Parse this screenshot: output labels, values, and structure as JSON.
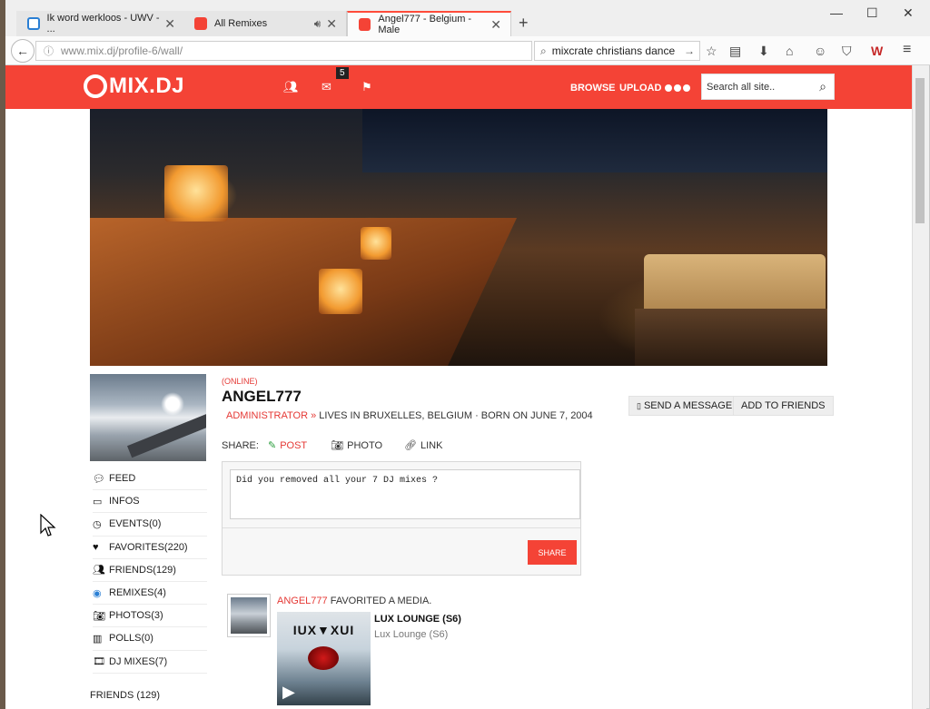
{
  "browser": {
    "tabs": [
      {
        "label": "Ik word werkloos - UWV - ...",
        "fav_color": "#2a7fd4"
      },
      {
        "label": "All Remixes",
        "fav_color": "#f44336"
      },
      {
        "label": "Angel777 - Belgium - Male",
        "fav_color": "#f44336"
      }
    ],
    "url_prefix": "www.mix.dj",
    "url_path": "/profile-6/wall/",
    "search_query": "mixcrate christians dance",
    "accent": "#ff4b3a"
  },
  "site": {
    "logo": "MIX.DJ",
    "message_count": "5",
    "nav_browse": "BROWSE",
    "nav_upload": "UPLOAD",
    "search_placeholder": "Search all site..",
    "brand_color": "#f44336"
  },
  "profile": {
    "status": "(ONLINE)",
    "username": "ANGEL777",
    "role": "ADMINISTRATOR »",
    "details": "LIVES IN BRUXELLES, BELGIUM · BORN ON JUNE 7, 2004",
    "send_message": "SEND A MESSAGE",
    "add_friends": "ADD TO FRIENDS"
  },
  "menu": {
    "items": [
      {
        "label": "FEED",
        "icon": "chat-bubbles-icon"
      },
      {
        "label": "INFOS",
        "icon": "laptop-icon"
      },
      {
        "label": "EVENTS(0)",
        "icon": "clock-icon"
      },
      {
        "label": "FAVORITES(220)",
        "icon": "heart-icon"
      },
      {
        "label": "FRIENDS(129)",
        "icon": "users-icon"
      },
      {
        "label": "REMIXES(4)",
        "icon": "globe-icon"
      },
      {
        "label": "PHOTOS(3)",
        "icon": "camera-icon"
      },
      {
        "label": "POLLS(0)",
        "icon": "bar-chart-icon"
      },
      {
        "label": "DJ MIXES(7)",
        "icon": "film-icon"
      }
    ],
    "friends_heading": "FRIENDS (129)"
  },
  "share": {
    "label": "SHARE:",
    "post": "POST",
    "photo": "PHOTO",
    "link": "LINK",
    "text": "Did you removed all your 7 DJ mixes ?",
    "button": "SHARE"
  },
  "feed": {
    "user": "ANGEL777",
    "action": " FAVORITED A MEDIA.",
    "media_title": "LUX LOUNGE (S6)",
    "media_sub": "Lux Lounge (S6)",
    "thumb_text": "IUX▼XUI"
  }
}
